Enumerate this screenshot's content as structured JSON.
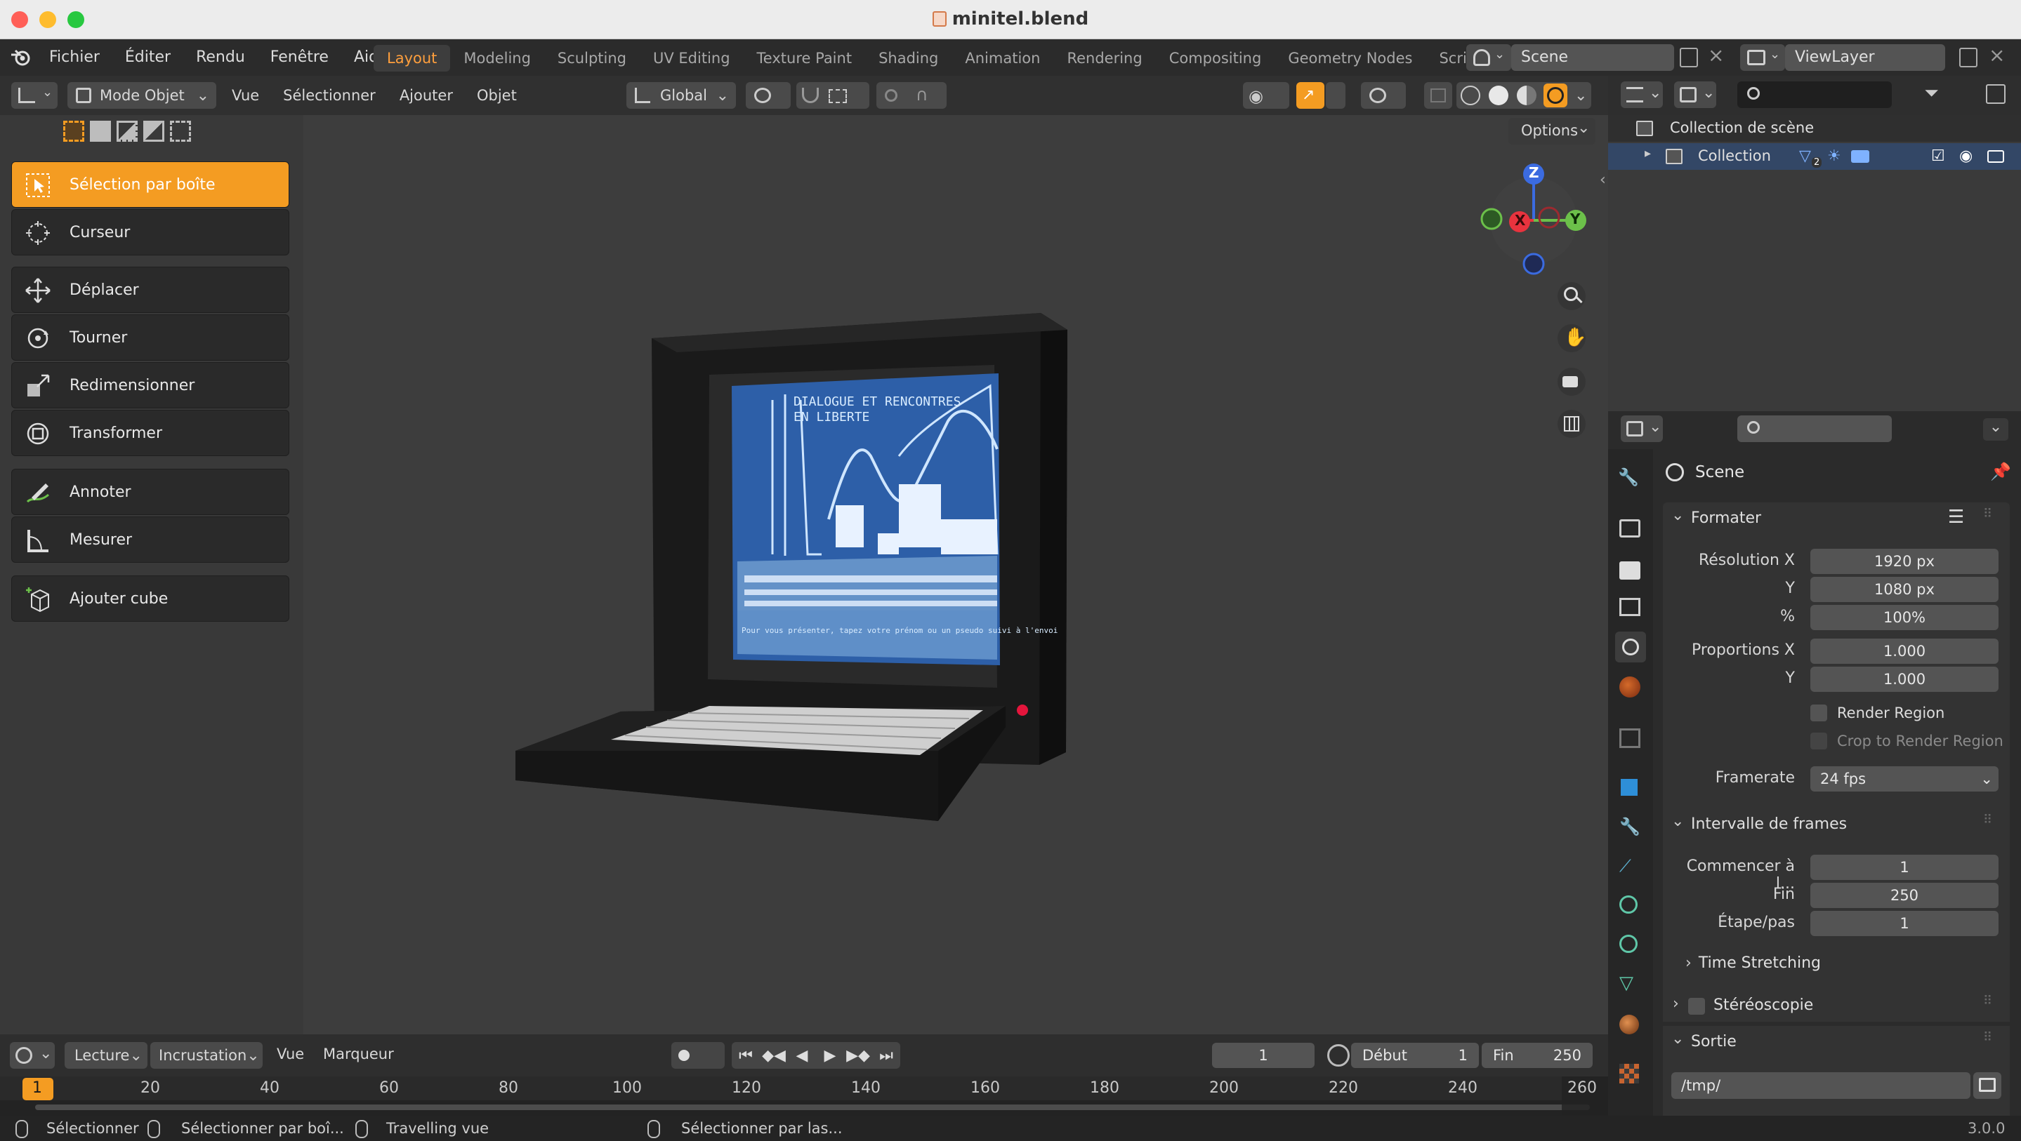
{
  "window": {
    "title": "minitel.blend",
    "title_icon": "blend-file-icon"
  },
  "menu": {
    "items": [
      "Fichier",
      "Éditer",
      "Rendu",
      "Fenêtre",
      "Aide"
    ],
    "workspaces": [
      "Layout",
      "Modeling",
      "Sculpting",
      "UV Editing",
      "Texture Paint",
      "Shading",
      "Animation",
      "Rendering",
      "Compositing",
      "Geometry Nodes",
      "Scripting"
    ],
    "active_workspace": "Layout",
    "scene_field": "Scene",
    "viewlayer_field": "ViewLayer"
  },
  "view_header": {
    "mode": "Mode Objet",
    "menus": [
      "Vue",
      "Sélectionner",
      "Ajouter",
      "Objet"
    ],
    "transform_orientation": "Global",
    "options_label": "Options"
  },
  "tools": [
    {
      "label": "Sélection par boîte",
      "icon": "select-box-icon",
      "active": true
    },
    {
      "label": "Curseur",
      "icon": "cursor-icon",
      "active": false
    },
    {
      "label": "Déplacer",
      "icon": "move-icon",
      "active": false
    },
    {
      "label": "Tourner",
      "icon": "rotate-icon",
      "active": false
    },
    {
      "label": "Redimensionner",
      "icon": "scale-icon",
      "active": false
    },
    {
      "label": "Transformer",
      "icon": "transform-icon",
      "active": false
    },
    {
      "label": "Annoter",
      "icon": "annotate-icon",
      "active": false
    },
    {
      "label": "Mesurer",
      "icon": "measure-icon",
      "active": false
    },
    {
      "label": "Ajouter cube",
      "icon": "add-cube-icon",
      "active": false
    }
  ],
  "viewport": {
    "gizmo": {
      "x": "X",
      "y": "Y",
      "z": "Z"
    },
    "screen_text_line1": "DIALOGUE ET RENCONTRES",
    "screen_text_line2": "EN LIBERTE",
    "screen_footer": "Pour vous présenter, tapez votre prénom ou un pseudo suivi à l'envoi"
  },
  "outliner": {
    "scene_collection": "Collection de scène",
    "collection": "Collection",
    "collection_badge": "2"
  },
  "properties": {
    "header": "Scene",
    "format_section": "Formater",
    "resolution_x_label": "Résolution X",
    "resolution_x": "1920 px",
    "resolution_y_label": "Y",
    "resolution_y": "1080 px",
    "percent_label": "%",
    "percent": "100%",
    "aspect_x_label": "Proportions X",
    "aspect_x": "1.000",
    "aspect_y_label": "Y",
    "aspect_y": "1.000",
    "render_region": "Render Region",
    "crop_region": "Crop to Render Region",
    "framerate_label": "Framerate",
    "framerate": "24 fps",
    "frame_range_section": "Intervalle de frames",
    "start_label": "Commencer à l...",
    "start": "1",
    "end_label": "Fin",
    "end": "250",
    "step_label": "Étape/pas",
    "step": "1",
    "time_stretching": "Time Stretching",
    "stereoscopy": "Stéréoscopie",
    "output_section": "Sortie",
    "output_path": "/tmp/"
  },
  "timeline": {
    "playback": "Lecture",
    "keying": "Incrustation",
    "view": "Vue",
    "marker": "Marqueur",
    "current_frame": "1",
    "start_label": "Début",
    "start": "1",
    "end_label": "Fin",
    "end": "250",
    "ticks": [
      "1",
      "20",
      "40",
      "60",
      "80",
      "100",
      "120",
      "140",
      "160",
      "180",
      "200",
      "220",
      "240",
      "260"
    ]
  },
  "status": {
    "select": "Sélectionner",
    "box_select": "Sélectionner par boî...",
    "travelling": "Travelling vue",
    "lasso": "Sélectionner par las...",
    "version": "3.0.0"
  },
  "colors": {
    "accent": "#f49c22",
    "active_tab": "#ff9f3d",
    "x_axis": "#e8333e",
    "y_axis": "#6cc04a",
    "z_axis": "#3b6be0"
  }
}
